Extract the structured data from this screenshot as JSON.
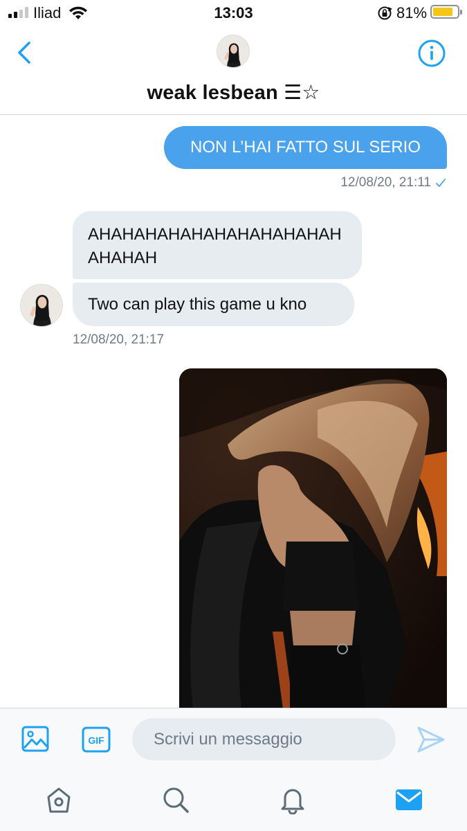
{
  "status_bar": {
    "carrier": "Iliad",
    "time": "13:03",
    "battery_percent": "81%",
    "battery_level": 0.81,
    "signal_bars_active": 2,
    "icons": [
      "signal-icon",
      "wifi-icon",
      "rotation-lock-icon",
      "battery-icon"
    ]
  },
  "header": {
    "title": "weak lesbean ☰☆",
    "back_icon": "chevron-left-icon",
    "info_icon": "info-icon"
  },
  "messages": {
    "outgoing": {
      "text": "NON L’HAI FATTO SUL SERIO",
      "timestamp": "12/08/20, 21:11",
      "read_icon": "checkmark-icon"
    },
    "incoming": [
      {
        "text": "AHAHAHAHAHAHAHAHAHAHAHAHAHAH"
      },
      {
        "text": "Two can play this game u kno"
      }
    ],
    "incoming_timestamp": "12/08/20, 21:17"
  },
  "composer": {
    "placeholder": "Scrivi un messaggio",
    "gif_label": "GIF",
    "icons": [
      "image-icon",
      "gif-icon",
      "send-icon"
    ]
  },
  "tabbar": {
    "icons": [
      "home-icon",
      "search-icon",
      "notifications-icon",
      "messages-icon"
    ],
    "active": "messages-icon"
  },
  "colors": {
    "accent": "#1da1f2",
    "outgoing_bubble": "#4aa1ec",
    "incoming_bubble": "#e6ecf0",
    "meta_text": "#6e7a85",
    "battery_fill": "#f5c518"
  }
}
